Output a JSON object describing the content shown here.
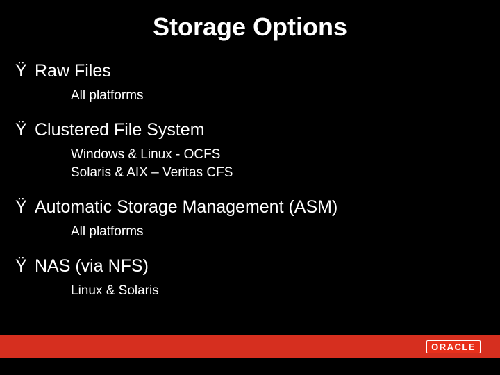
{
  "title": "Storage Options",
  "bullets": {
    "top_mark": "Ÿ",
    "sub_mark": "–"
  },
  "groups": [
    {
      "label": "Raw Files",
      "subs": [
        "All platforms"
      ]
    },
    {
      "label": "Clustered File System",
      "subs": [
        "Windows & Linux - OCFS",
        "Solaris & AIX – Veritas CFS"
      ]
    },
    {
      "label": "Automatic Storage Management (ASM)",
      "subs": [
        "All platforms"
      ]
    },
    {
      "label": "NAS (via NFS)",
      "subs": [
        "Linux & Solaris"
      ]
    }
  ],
  "footer": {
    "logo_text": "ORACLE"
  }
}
